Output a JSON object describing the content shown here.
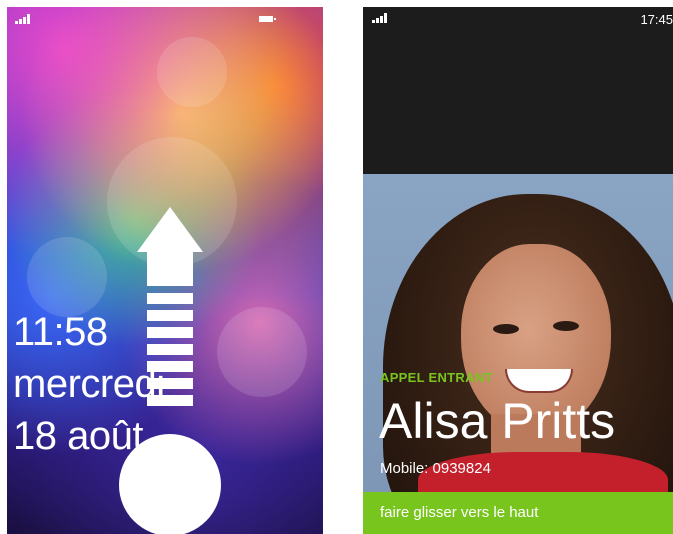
{
  "lock_screen": {
    "time": "11:58",
    "day": "mercredi",
    "date": "18 août",
    "icons": {
      "signal": "signal-strength-icon",
      "battery": "battery-icon",
      "arrow": "slide-up-arrow-icon"
    }
  },
  "incoming_call": {
    "status_time": "17:45",
    "label": "APPEL ENTRANT",
    "caller_name": "Alisa Pritts",
    "caller_number": "Mobile: 0939824",
    "slide_action": "faire glisser vers le haut",
    "accent_color": "#78c51e"
  }
}
